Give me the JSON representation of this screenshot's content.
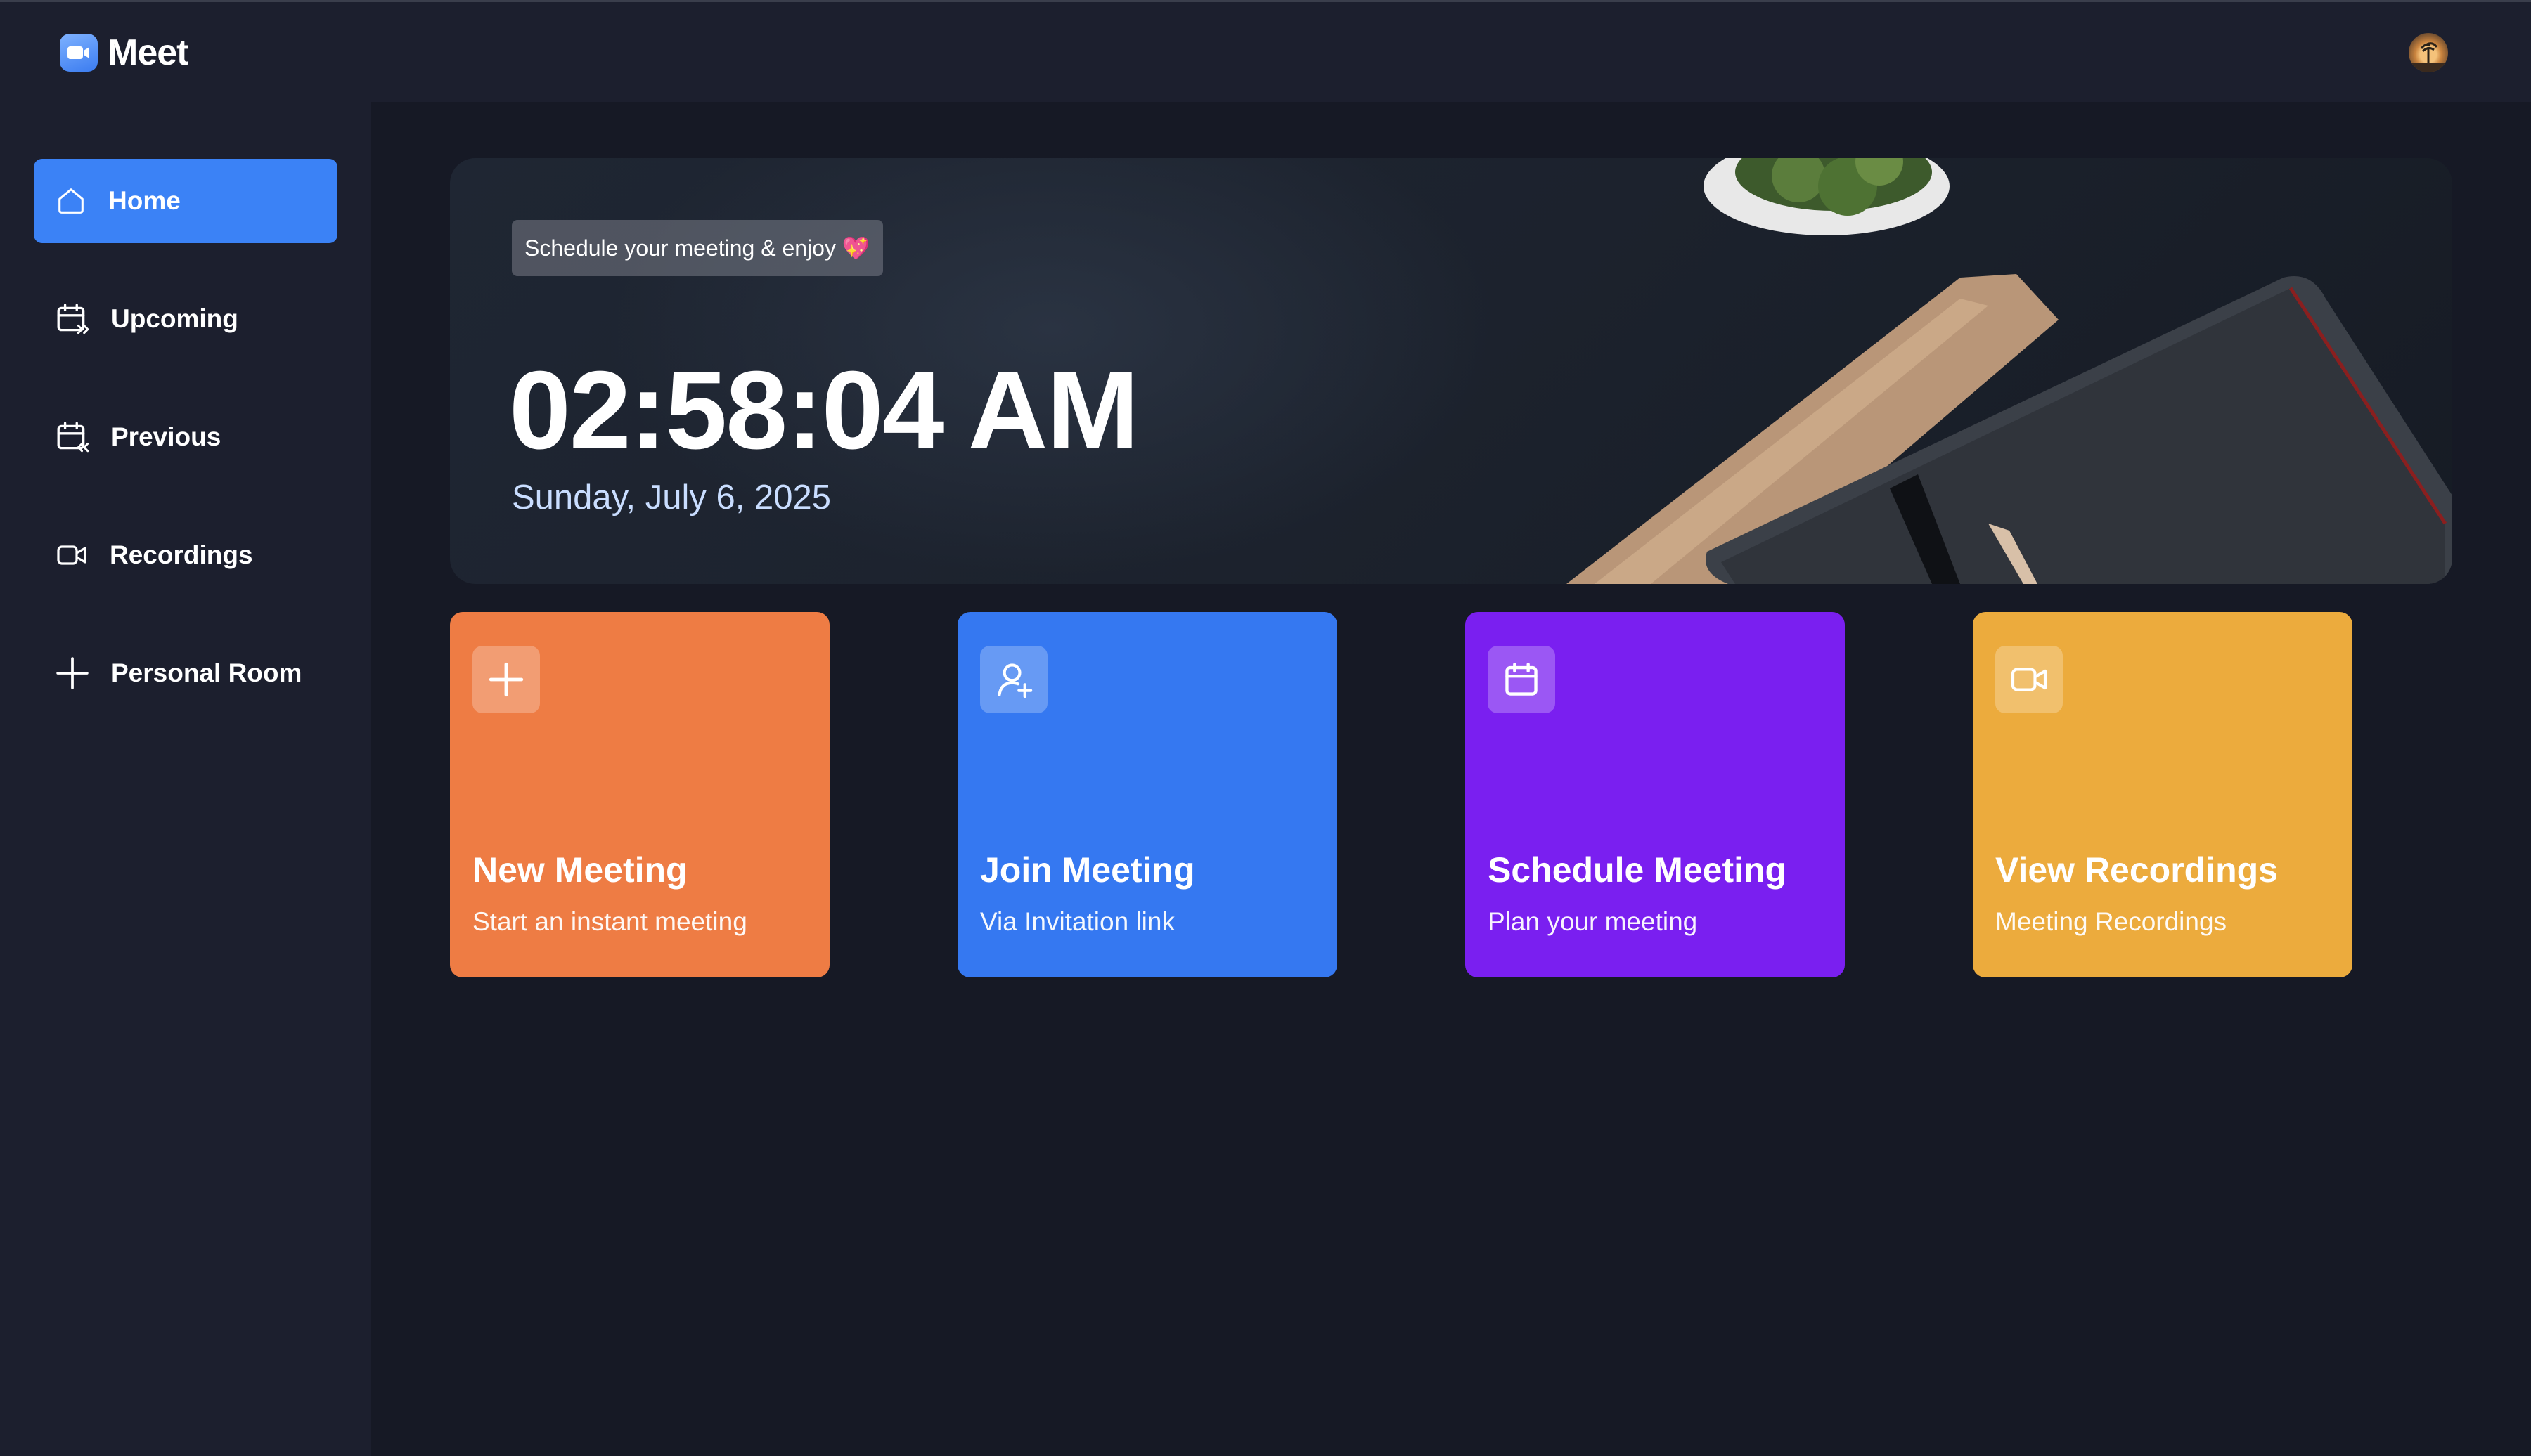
{
  "app": {
    "name": "Meet"
  },
  "colors": {
    "background": "#161925",
    "panel": "#1c1f2e",
    "active_nav": "#3b82f6",
    "card_new": "#ee7c44",
    "card_join": "#3578f1",
    "card_schedule": "#7a1ff0",
    "card_recordings": "#ecab3d"
  },
  "sidebar": {
    "items": [
      {
        "label": "Home",
        "icon": "home-icon",
        "active": true
      },
      {
        "label": "Upcoming",
        "icon": "calendar-forward-icon",
        "active": false
      },
      {
        "label": "Previous",
        "icon": "calendar-back-icon",
        "active": false
      },
      {
        "label": "Recordings",
        "icon": "video-icon",
        "active": false
      },
      {
        "label": "Personal Room",
        "icon": "plus-icon",
        "active": false
      }
    ]
  },
  "hero": {
    "badge": "Schedule your meeting & enjoy 💖",
    "time": "02:58:04 AM",
    "date": "Sunday, July 6, 2025"
  },
  "cards": [
    {
      "title": "New Meeting",
      "subtitle": "Start an instant meeting",
      "icon": "plus-icon"
    },
    {
      "title": "Join Meeting",
      "subtitle": "Via Invitation link",
      "icon": "add-user-icon"
    },
    {
      "title": "Schedule Meeting",
      "subtitle": "Plan your meeting",
      "icon": "calendar-icon"
    },
    {
      "title": "View Recordings",
      "subtitle": "Meeting Recordings",
      "icon": "video-icon"
    }
  ]
}
